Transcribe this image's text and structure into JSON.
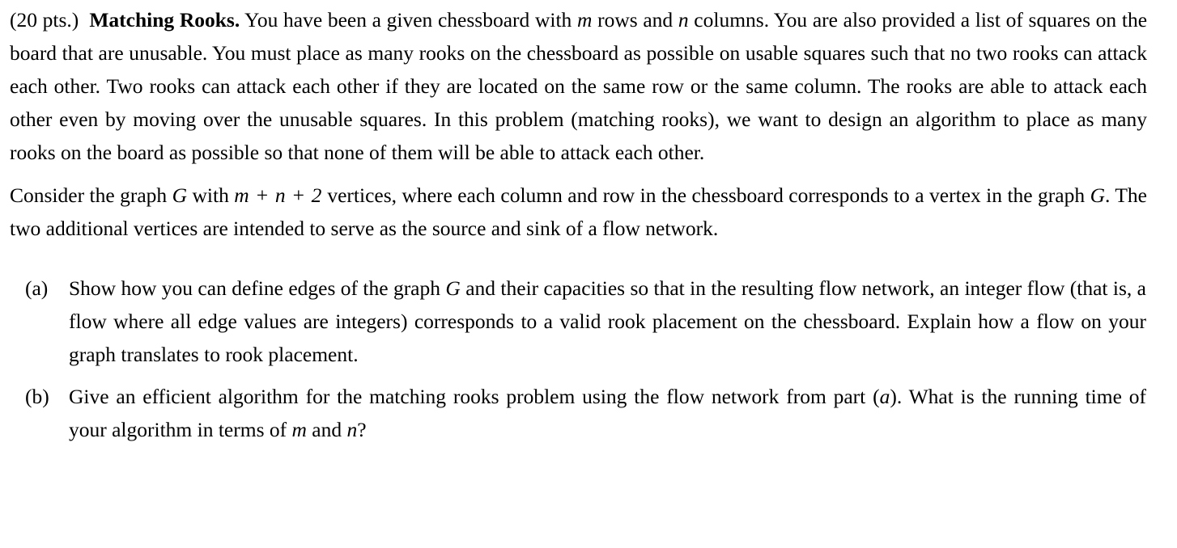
{
  "document": {
    "points_label": "(20 pts.)",
    "title": "Matching Rooks.",
    "intro_paragraph": {
      "text_part_1": "You have been a given chessboard with ",
      "var_m": "m",
      "text_part_2": " rows and ",
      "var_n": "n",
      "text_part_3": " columns. You are also provided a list of squares on the board that are unusable. You must place as many rooks on the chessboard as possible on usable squares such that no two rooks can attack each other. Two rooks can attack each other if they are located on the same row or the same column. The rooks are able to attack each other even by moving over the unusable squares. In this problem (matching rooks), we want to design an algorithm to place as many rooks on the board as possible so that none of them will be able to attack each other."
    },
    "graph_paragraph": {
      "text_part_1": "Consider the graph ",
      "var_G_1": "G",
      "text_part_2": " with ",
      "math_expr": "m + n + 2",
      "text_part_3": " vertices, where each column and row in the chessboard corresponds to a vertex in the graph ",
      "var_G_2": "G",
      "text_part_4": ". The two additional vertices are intended to serve as the source and sink of a flow network."
    },
    "enumeration": [
      {
        "label": "(a)",
        "text_part_1": "Show how you can define edges of the graph ",
        "var_G": "G",
        "text_part_2": " and their capacities so that in the resulting flow network, an integer flow (that is, a flow where all edge values are integers) corresponds to a valid rook placement on the chessboard. Explain how a flow on your graph translates to rook placement."
      },
      {
        "label": "(b)",
        "text_part_1": "Give an efficient algorithm for the matching rooks problem using the flow network from part (",
        "var_a": "a",
        "text_part_2": "). What is the running time of your algorithm in terms of ",
        "var_m": "m",
        "text_part_3": " and ",
        "var_n": "n",
        "text_part_4": "?"
      }
    ]
  }
}
